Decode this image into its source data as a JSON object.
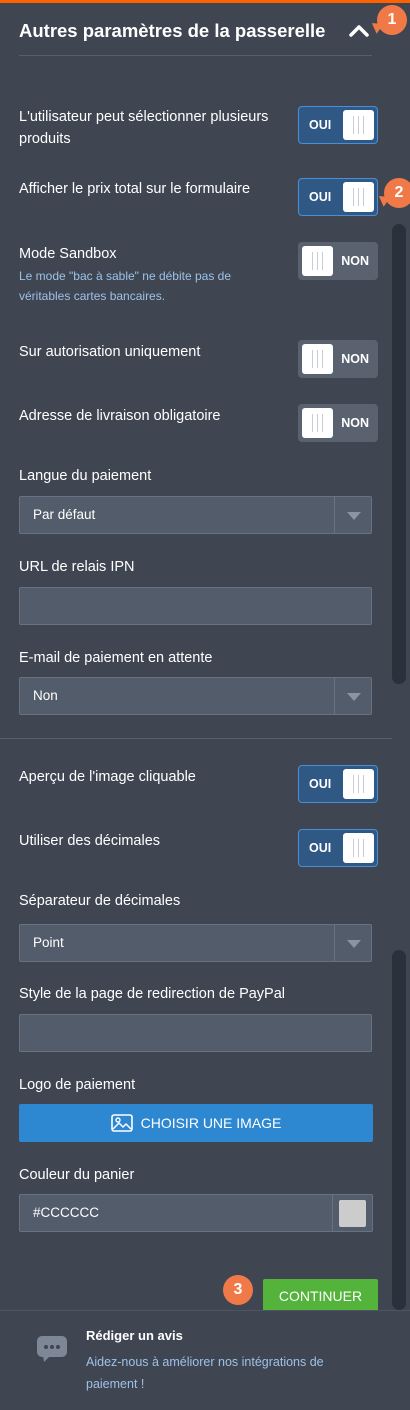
{
  "section": {
    "title": "Autres paramètres de la passerelle"
  },
  "badges": {
    "one": "1",
    "two": "2",
    "three": "3"
  },
  "settings": {
    "multi_products": {
      "label": "L'utilisateur peut sélectionner plusieurs produits",
      "state": "OUI"
    },
    "total_price": {
      "label": "Afficher le prix total sur le formulaire",
      "state": "OUI"
    },
    "sandbox": {
      "label": "Mode Sandbox",
      "hint": "Le mode \"bac à sable\" ne débite pas de véritables cartes bancaires.",
      "state": "NON"
    },
    "auth_only": {
      "label": "Sur autorisation uniquement",
      "state": "NON"
    },
    "shipping_required": {
      "label": "Adresse de livraison obligatoire",
      "state": "NON"
    },
    "payment_language": {
      "label": "Langue du paiement",
      "value": "Par défaut"
    },
    "ipn_url": {
      "label": "URL de relais IPN",
      "value": ""
    },
    "pending_email": {
      "label": "E-mail de paiement en attente",
      "value": "Non"
    },
    "image_preview": {
      "label": "Aperçu de l'image cliquable",
      "state": "OUI"
    },
    "use_decimals": {
      "label": "Utiliser des décimales",
      "state": "OUI"
    },
    "decimal_separator": {
      "label": "Séparateur de décimales",
      "value": "Point"
    },
    "paypal_style": {
      "label": "Style de la page de redirection de PayPal",
      "value": ""
    },
    "payment_logo": {
      "label": "Logo de paiement",
      "button": "CHOISIR UNE IMAGE"
    },
    "cart_color": {
      "label": "Couleur du panier",
      "value": "#CCCCCC"
    }
  },
  "actions": {
    "continue": "CONTINUER"
  },
  "footer": {
    "title": "Rédiger un avis",
    "subtitle": "Aidez-nous à améliorer nos intégrations de paiement !"
  },
  "colors": {
    "accent": "#ff6100",
    "background": "#3f4652",
    "toggle_on": "#2f5885",
    "button_blue": "#2d87d1",
    "button_green": "#53b33b",
    "badge": "#f07a47",
    "swatch": "#cccccc"
  }
}
